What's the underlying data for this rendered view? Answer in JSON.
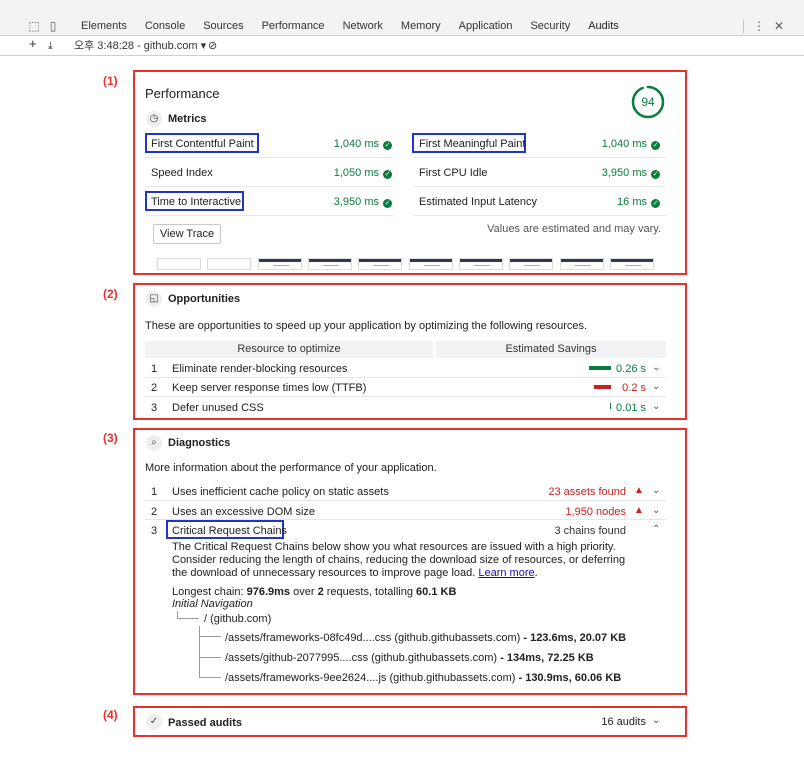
{
  "devtools": {
    "tabs": [
      "Elements",
      "Console",
      "Sources",
      "Performance",
      "Network",
      "Memory",
      "Application",
      "Security",
      "Audits"
    ],
    "active_tab": "Audits",
    "subbar": {
      "report_label": "오후 3:48:28 - github.com",
      "dropdown_arrow": "▾"
    },
    "more_icon": "⋮",
    "close_icon": "✕"
  },
  "annotations": [
    "(1)",
    "(2)",
    "(3)",
    "(4)"
  ],
  "performance": {
    "title": "Performance",
    "score": "94",
    "metrics_heading": "Metrics",
    "metrics": [
      {
        "label": "First Contentful Paint",
        "value": "1,040 ms"
      },
      {
        "label": "First Meaningful Paint",
        "value": "1,040 ms"
      },
      {
        "label": "Speed Index",
        "value": "1,050 ms"
      },
      {
        "label": "First CPU Idle",
        "value": "3,950 ms"
      },
      {
        "label": "Time to Interactive",
        "value": "3,950 ms"
      },
      {
        "label": "Estimated Input Latency",
        "value": "16 ms"
      }
    ],
    "view_trace_label": "View Trace",
    "estimate_note": "Values are estimated and may vary."
  },
  "opportunities": {
    "title": "Opportunities",
    "description": "These are opportunities to speed up your application by optimizing the following resources.",
    "col_resource": "Resource to optimize",
    "col_savings": "Estimated Savings",
    "items": [
      {
        "num": "1",
        "label": "Eliminate render-blocking resources",
        "savings": "0.26 s",
        "bar_fraction": 1.0,
        "color": "#0a7c3e"
      },
      {
        "num": "2",
        "label": "Keep server response times low (TTFB)",
        "savings": "0.2 s",
        "bar_fraction": 0.77,
        "color": "#c5221f"
      },
      {
        "num": "3",
        "label": "Defer unused CSS",
        "savings": "0.01 s",
        "bar_fraction": 0.04,
        "color": "#0a7c3e"
      }
    ]
  },
  "diagnostics": {
    "title": "Diagnostics",
    "description": "More information about the performance of your application.",
    "items": [
      {
        "num": "1",
        "label": "Uses inefficient cache policy on static assets",
        "value": "23 assets found"
      },
      {
        "num": "2",
        "label": "Uses an excessive DOM size",
        "value": "1,950 nodes"
      },
      {
        "num": "3",
        "label": "Critical Request Chains",
        "value": "3 chains found"
      }
    ],
    "crc_description": "The Critical Request Chains below show you what resources are issued with a high priority. Consider reducing the length of chains, reducing the download size of resources, or deferring the download of unnecessary resources to improve page load.",
    "learn_more": "Learn more",
    "longest_chain_prefix": "Longest chain: ",
    "longest_chain_time": "976.9ms",
    "longest_chain_mid": " over ",
    "longest_chain_count": "2",
    "longest_chain_mid2": " requests, totalling ",
    "longest_chain_size": "60.1 KB",
    "initial_navigation": "Initial Navigation",
    "root": "/ (github.com)",
    "chains": [
      {
        "url": "/assets/frameworks-08fc49d....css (github.githubassets.com)",
        "stats": " - 123.6ms, 20.07 KB"
      },
      {
        "url": "/assets/github-2077995....css (github.githubassets.com)",
        "stats": " - 134ms, 72.25 KB"
      },
      {
        "url": "/assets/frameworks-9ee2624....js (github.githubassets.com)",
        "stats": " - 130.9ms, 60.06 KB"
      }
    ]
  },
  "passed": {
    "title": "Passed audits",
    "count": "16 audits"
  },
  "colors": {
    "annotation_red": "#e8322d",
    "highlight_blue": "#1f35c9",
    "pass_green": "#0a7c3e",
    "fail_red": "#c5221f"
  }
}
